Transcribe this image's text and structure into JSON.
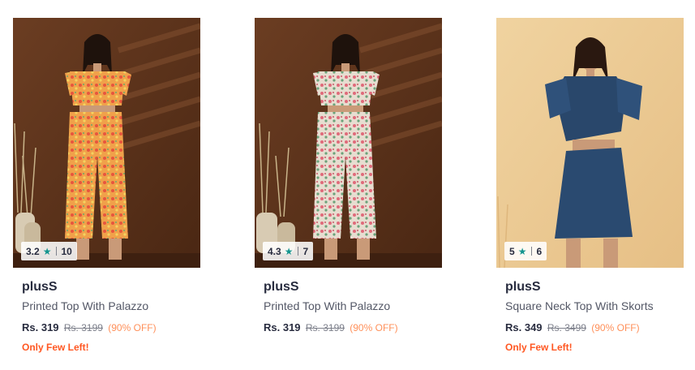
{
  "colors": {
    "accent_star": "#14958f",
    "offer": "#ff905a",
    "few_left": "#ff5722",
    "text_dark": "#282c3f",
    "text_muted": "#535766"
  },
  "products": [
    {
      "rating": "3.2",
      "rating_count": "10",
      "brand": "plusS",
      "name": "Printed Top With Palazzo",
      "price": "Rs. 319",
      "mrp": "Rs. 3199",
      "discount": "(90% OFF)",
      "stock_note": "Only Few Left!"
    },
    {
      "rating": "4.3",
      "rating_count": "7",
      "brand": "plusS",
      "name": "Printed Top With Palazzo",
      "price": "Rs. 319",
      "mrp": "Rs. 3199",
      "discount": "(90% OFF)",
      "stock_note": ""
    },
    {
      "rating": "5",
      "rating_count": "6",
      "brand": "plusS",
      "name": "Square Neck Top With Skorts",
      "price": "Rs. 349",
      "mrp": "Rs. 3499",
      "discount": "(90% OFF)",
      "stock_note": "Only Few Left!"
    }
  ]
}
